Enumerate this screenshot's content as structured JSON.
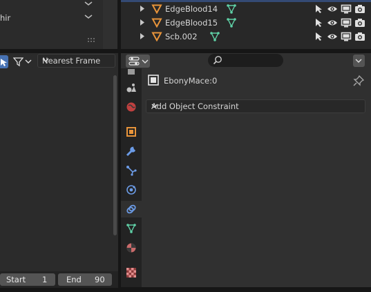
{
  "top_left_panel": {
    "dropdown_text": "hir"
  },
  "outliner": {
    "rows": [
      {
        "name": "EdgeBlood14"
      },
      {
        "name": "EdgeBlood15"
      },
      {
        "name": "Scb.002"
      }
    ]
  },
  "dopesheet": {
    "interpolation_value": "Nearest Frame"
  },
  "timeline": {
    "start_label": "Start",
    "start_value": "1",
    "end_label": "End",
    "end_value": "90"
  },
  "properties": {
    "object_name": "EbonyMace:0",
    "add_constraint_label": "Add Object Constraint",
    "tabs": [
      "tool-icon",
      "render-icon",
      "output-icon",
      "view-layer-icon",
      "scene-icon",
      "world-icon",
      "object-icon",
      "modifier-icon",
      "particles-icon",
      "physics-icon",
      "object-constraint-icon",
      "object-data-icon",
      "material-icon",
      "texture-icon"
    ]
  },
  "colors": {
    "accent_blue": "#4772b3",
    "object_orange": "#e8943a",
    "mesh_green": "#5fd0a6",
    "selection_bar": "#344a74"
  }
}
